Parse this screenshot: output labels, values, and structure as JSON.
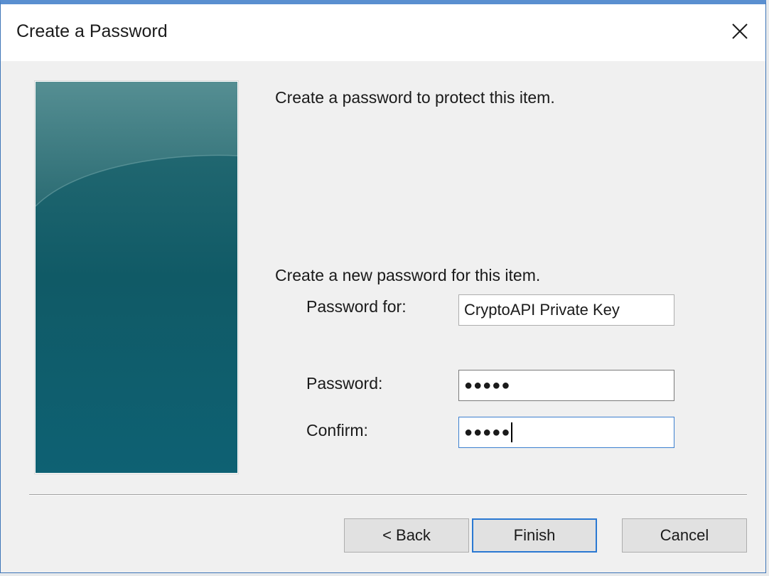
{
  "window": {
    "title": "Create a Password"
  },
  "content": {
    "intro": "Create a password to protect this item.",
    "section_heading": "Create a new password for this item."
  },
  "fields": {
    "password_for": {
      "label": "Password for:",
      "value": "CryptoAPI Private Key"
    },
    "password": {
      "label": "Password:",
      "value": "●●●●●"
    },
    "confirm": {
      "label": "Confirm:",
      "value": "●●●●●"
    }
  },
  "buttons": {
    "back": "< Back",
    "finish": "Finish",
    "cancel": "Cancel"
  },
  "colors": {
    "title_bar_accent": "#5a8fd0",
    "panel_teal": "#135e6a",
    "focus_blue": "#3c7fcf"
  },
  "icons": {
    "close": "close-icon"
  }
}
